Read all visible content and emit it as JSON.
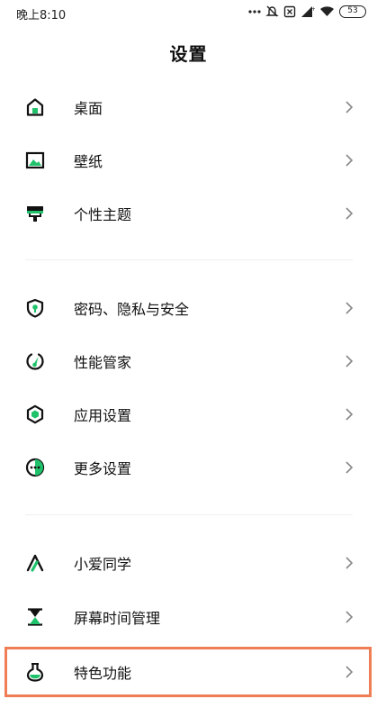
{
  "status_bar": {
    "time": "晚上8:10",
    "battery_level": "53",
    "icons": [
      "more-dots-icon",
      "mute-icon",
      "sim-off-icon",
      "signal-icon",
      "wifi-icon",
      "battery-icon"
    ]
  },
  "header": {
    "title": "设置"
  },
  "sections": [
    {
      "items": [
        {
          "label": "桌面",
          "icon": "home-icon"
        },
        {
          "label": "壁纸",
          "icon": "wallpaper-icon"
        },
        {
          "label": "个性主题",
          "icon": "theme-brush-icon"
        }
      ]
    },
    {
      "items": [
        {
          "label": "密码、隐私与安全",
          "icon": "shield-lock-icon"
        },
        {
          "label": "性能管家",
          "icon": "gauge-icon"
        },
        {
          "label": "应用设置",
          "icon": "hexagon-icon"
        },
        {
          "label": "更多设置",
          "icon": "more-circle-icon"
        }
      ]
    },
    {
      "items": [
        {
          "label": "小爱同学",
          "icon": "xiaoai-icon"
        },
        {
          "label": "屏幕时间管理",
          "icon": "hourglass-icon"
        },
        {
          "label": "特色功能",
          "icon": "flask-icon",
          "highlighted": true
        }
      ]
    }
  ],
  "colors": {
    "accent": "#1fc26b",
    "icon_dark": "#111111",
    "highlight_border": "#ef7d55"
  }
}
